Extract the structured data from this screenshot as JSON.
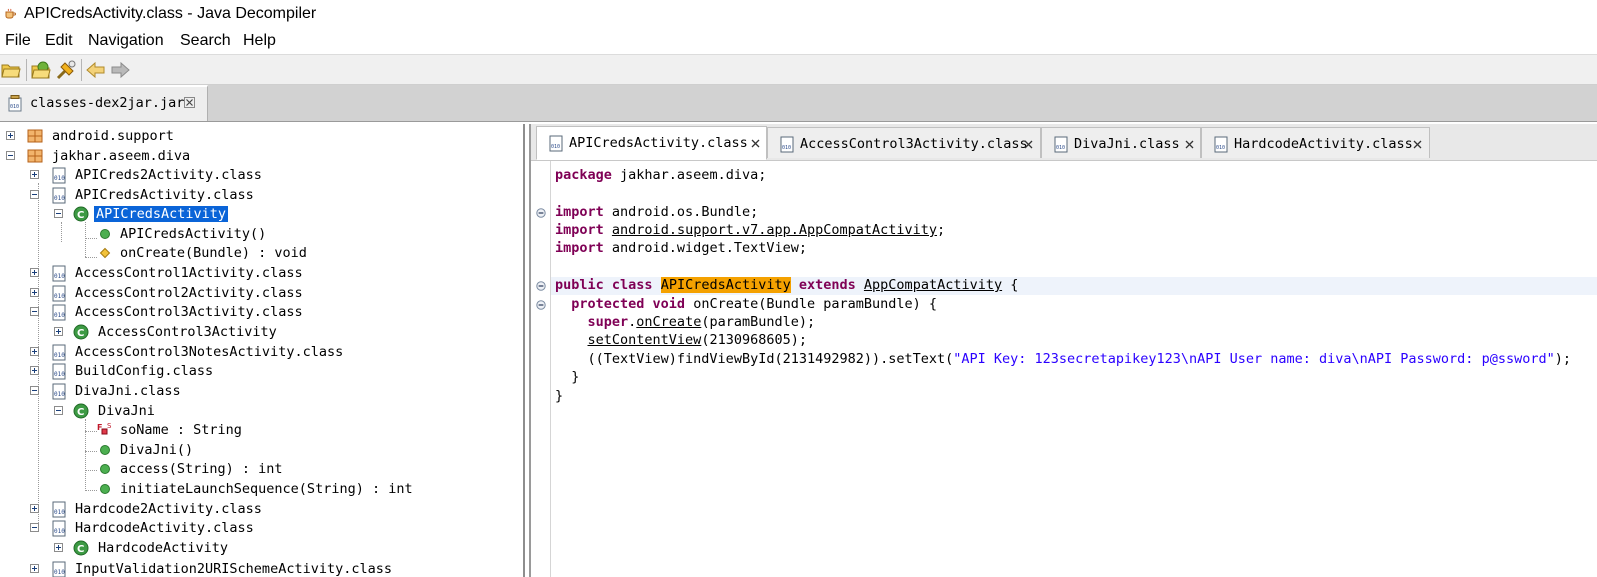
{
  "window": {
    "title": "APICredsActivity.class - Java Decompiler"
  },
  "menu": {
    "items": [
      "File",
      "Edit",
      "Navigation",
      "Search",
      "Help"
    ]
  },
  "toolbar": {
    "buttons": [
      "open-file-icon",
      "open-type-icon",
      "open-type-hierarchy-icon",
      "back-arrow-icon",
      "forward-arrow-icon"
    ]
  },
  "file_tab": {
    "label": "classes-dex2jar.jar"
  },
  "tree": {
    "rows": [
      "android.support",
      "jakhar.aseem.diva",
      "APICreds2Activity.class",
      "APICredsActivity.class",
      "APICredsActivity",
      "APICredsActivity()",
      "onCreate(Bundle) : void",
      "AccessControl1Activity.class",
      "AccessControl2Activity.class",
      "AccessControl3Activity.class",
      "AccessControl3Activity",
      "AccessControl3NotesActivity.class",
      "BuildConfig.class",
      "DivaJni.class",
      "DivaJni",
      "soName : String",
      "DivaJni()",
      "access(String) : int",
      "initiateLaunchSequence(String) : int",
      "Hardcode2Activity.class",
      "HardcodeActivity.class",
      "HardcodeActivity",
      "InputValidation2URISchemeActivity.class"
    ]
  },
  "editor": {
    "tabs": [
      "APICredsActivity.class",
      "AccessControl3Activity.class",
      "DivaJni.class",
      "HardcodeActivity.class"
    ],
    "active_tab": "APICredsActivity.class",
    "code": {
      "package_kw": "package",
      "package_name": " jakhar.aseem.diva;",
      "import_kw": "import",
      "import1": " android.os.Bundle;",
      "import2_pkg": "android.support.v7.app.AppCompatActivity",
      "import2_end": ";",
      "import3": " android.widget.TextView;",
      "public_class_kw": "public class",
      "class_name": "APICredsActivity",
      "extends_kw": "extends",
      "super_class": "AppCompatActivity",
      "open_brace": " {",
      "protected_void_kw": "protected void",
      "oncreate_sig": " onCreate(Bundle paramBundle) {",
      "super_kw": "super",
      "dot": ".",
      "oncreate_call": "onCreate",
      "oncreate_args": "(paramBundle);",
      "setcontentview": "setContentView",
      "setcontentview_args": "(2130968605);",
      "settext_prefix": "((TextView)findViewById(2131492982)).setText(",
      "settext_string": "\"API Key: 123secretapikey123\\nAPI User name: diva\\nAPI Password: p@ssword\"",
      "settext_suffix": ");",
      "close_method": "}",
      "close_class": "}"
    }
  },
  "colors": {
    "selection": "#0a64d8",
    "keyword": "#7f0055",
    "string": "#2a00ff",
    "search_highlight": "#f4a100"
  }
}
